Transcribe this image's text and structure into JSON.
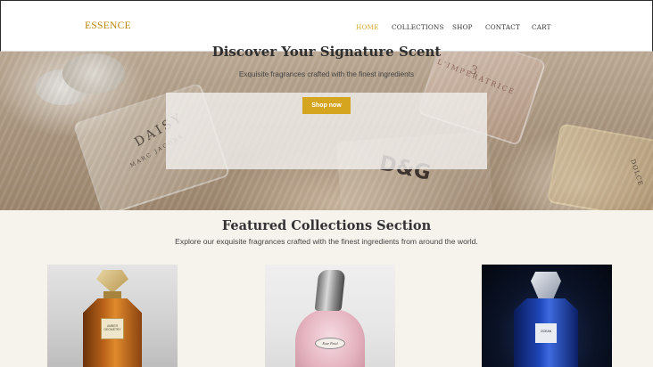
{
  "header": {
    "logo": "ESSENCE",
    "nav": [
      {
        "label": "HOME",
        "active": true
      },
      {
        "label": "COLLECTIONS",
        "active": false
      },
      {
        "label": "SHOP",
        "active": false
      },
      {
        "label": "CONTACT",
        "active": false
      },
      {
        "label": "CART",
        "active": false
      }
    ]
  },
  "hero": {
    "title": "Discover Your Signature Scent",
    "subtitle": "Exquisite fragrances crafted with the finest ingredients",
    "button_label": "Shop now",
    "image_text": {
      "daisy": "DAISY",
      "marc_jacobs": "MARC JACOBS",
      "three": "3",
      "imperatrice": "L'IMPERATRICE",
      "dg": "D&G",
      "dolce": "DOLCE"
    }
  },
  "featured": {
    "title": "Featured Collections Section",
    "subtitle": "Explore our exquisite fragrances crafted with the finest ingredients from around the world.",
    "products": [
      {
        "label_text": "AMBER GEOMETRY"
      },
      {
        "label_text": "Rose Petal"
      },
      {
        "label_text": "OCEAN"
      }
    ]
  },
  "colors": {
    "accent_gold": "#d6a520",
    "logo_gold": "#b8860b",
    "page_bg": "#f6f2ec"
  }
}
